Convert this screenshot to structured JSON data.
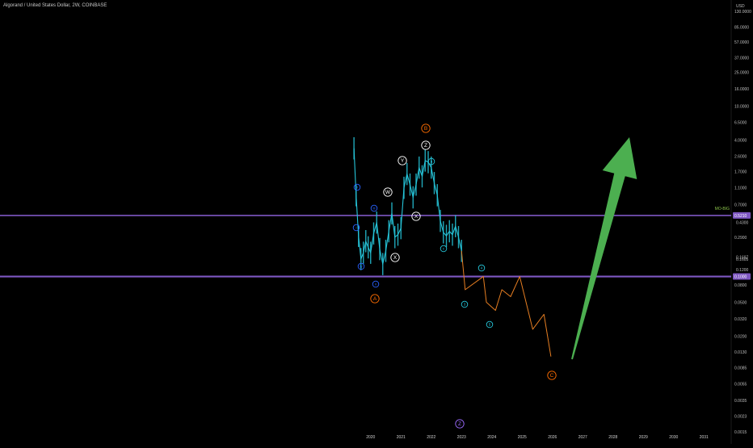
{
  "header": {
    "title": "Algorand / United States Dollar, 2W, COINBASE",
    "currency": "USD"
  },
  "colors": {
    "background": "#000000",
    "price": "#26c6da",
    "projection": "#e67e22",
    "level_line": "#7e57c2",
    "arrow": "#4caf50",
    "label_light": "#ffffff",
    "label_blue": "#2962ff",
    "label_cyan": "#26c6da",
    "label_orange": "#ff6d00"
  },
  "chart_data": {
    "type": "line",
    "title": "Algorand / United States Dollar, 2W, COINBASE",
    "y_scale": "log",
    "ylim": [
      0.0015,
      130
    ],
    "y_ticks": [
      "130.0000",
      "85.0000",
      "57.0000",
      "37.0000",
      "25.0000",
      "16.0000",
      "10.0000",
      "6.5000",
      "4.0000",
      "2.6000",
      "1.7000",
      "1.1000",
      "0.7000",
      "0.2900",
      "0.0800",
      "0.0500",
      "0.0320",
      "0.0200",
      "0.0130",
      "0.0085",
      "0.0055",
      "0.0035",
      "0.0023",
      "0.0015"
    ],
    "x_ticks": [
      "2020",
      "2021",
      "2022",
      "2023",
      "2024",
      "2025",
      "2026",
      "2027",
      "2028",
      "2029",
      "2030",
      "2031"
    ],
    "levels": [
      {
        "label": "MO-BIG",
        "value": 0.521,
        "price_label": "0.5210"
      },
      {
        "label": "",
        "value": 0.1,
        "price_label": "0.1000"
      }
    ],
    "price_tags": [
      "0.4300",
      "0.1697",
      "0.1605",
      "0.1200"
    ],
    "series": [
      {
        "type": "price",
        "x": [
          2019.45,
          2019.52,
          2019.6,
          2019.68,
          2019.76,
          2019.84,
          2019.92,
          2020.0,
          2020.1,
          2020.2,
          2020.3,
          2020.4,
          2020.5,
          2020.6,
          2020.7,
          2020.8,
          2020.9,
          2021.0,
          2021.1,
          2021.2,
          2021.3,
          2021.4,
          2021.5,
          2021.6,
          2021.7,
          2021.8,
          2021.9,
          2022.0,
          2022.1,
          2022.2,
          2022.3,
          2022.4,
          2022.5,
          2022.6,
          2022.7,
          2022.8,
          2022.9,
          2023.0
        ],
        "y": [
          3.2,
          0.9,
          0.3,
          0.16,
          0.19,
          0.26,
          0.22,
          0.19,
          0.32,
          0.43,
          0.21,
          0.14,
          0.2,
          0.34,
          0.55,
          0.29,
          0.31,
          0.37,
          1.1,
          1.6,
          1.2,
          0.85,
          1.2,
          1.9,
          1.5,
          2.3,
          2.2,
          1.9,
          1.25,
          0.9,
          0.45,
          0.33,
          0.3,
          0.34,
          0.31,
          0.39,
          0.29,
          0.2
        ]
      },
      {
        "type": "projection",
        "x": [
          2023.0,
          2023.12,
          2023.72,
          2023.82,
          2024.12,
          2024.33,
          2024.62,
          2024.92,
          2025.35,
          2025.72,
          2025.95
        ],
        "y": [
          0.2,
          0.07,
          0.1,
          0.05,
          0.04,
          0.07,
          0.058,
          0.1,
          0.024,
          0.036,
          0.0115
        ]
      }
    ],
    "wave_labels": [
      {
        "text": "B",
        "color": "orange"
      },
      {
        "text": "Z",
        "color": "white"
      },
      {
        "text": "Y",
        "color": "white"
      },
      {
        "text": "W",
        "color": "white"
      },
      {
        "text": "X",
        "color": "white"
      },
      {
        "text": "X",
        "color": "white"
      },
      {
        "text": "A",
        "color": "orange"
      },
      {
        "text": "C",
        "color": "orange"
      },
      {
        "text": "Z",
        "color": "purple"
      },
      {
        "text": "ii",
        "color": "blue"
      },
      {
        "text": "iii",
        "color": "blue"
      },
      {
        "text": "i",
        "color": "blue"
      },
      {
        "text": "iv",
        "color": "blue"
      },
      {
        "text": "v",
        "color": "blue"
      },
      {
        "text": "a",
        "color": "cyan"
      },
      {
        "text": "c",
        "color": "cyan"
      },
      {
        "text": "4",
        "color": "cyan"
      },
      {
        "text": "3",
        "color": "cyan"
      },
      {
        "text": "5",
        "color": "cyan"
      }
    ]
  }
}
